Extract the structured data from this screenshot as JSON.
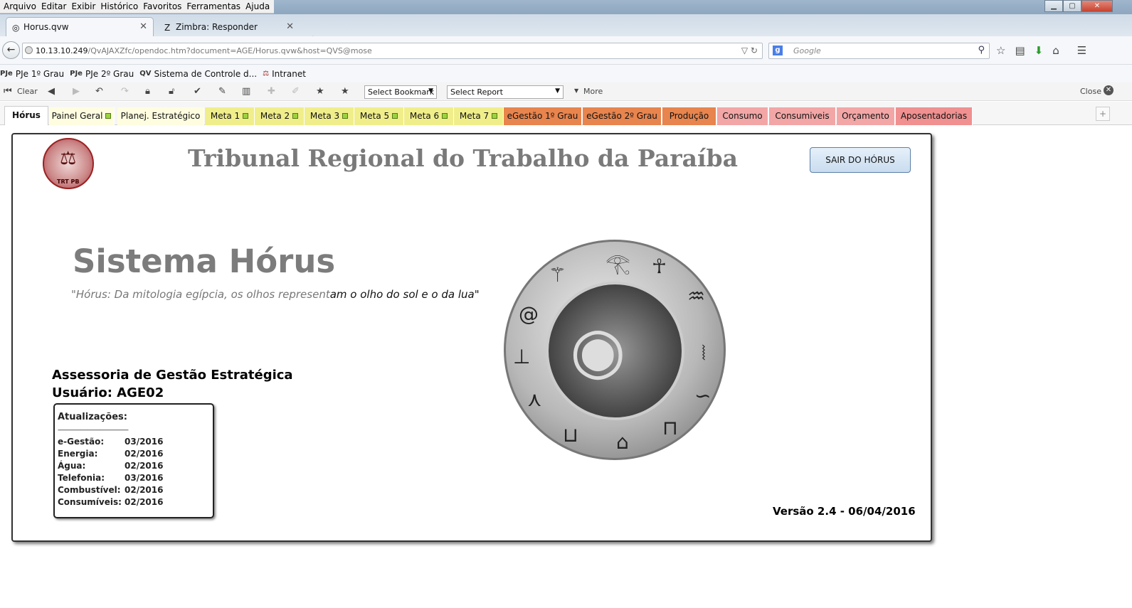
{
  "menubar": [
    "Arquivo",
    "Editar",
    "Exibir",
    "Histórico",
    "Favoritos",
    "Ferramentas",
    "Ajuda"
  ],
  "browser_tabs": [
    {
      "label": "Horus.qvw",
      "active": true
    },
    {
      "label": "Zimbra: Responder",
      "active": false
    }
  ],
  "url": {
    "host": "10.13.10.249",
    "path": "/QvAJAXZfc/opendoc.htm?document=AGE/Horus.qvw&host=QVS@mose"
  },
  "search": {
    "placeholder": "Google"
  },
  "bookmarks": [
    {
      "icon": "PJe",
      "label": "PJe 1º Grau"
    },
    {
      "icon": "PJe",
      "label": "PJe 2º Grau"
    },
    {
      "icon": "QV",
      "label": "Sistema de Controle d..."
    },
    {
      "icon": "⚖",
      "label": "Intranet"
    }
  ],
  "qv_toolbar": {
    "clear": "Clear",
    "select_bookmark": "Select Bookmark",
    "select_report": "Select Report",
    "more": "More",
    "close": "Close"
  },
  "sheet_tabs": [
    {
      "label": "Hórus",
      "color": "#ffffff",
      "dot": false
    },
    {
      "label": "Painel Geral",
      "color": "#fffde0",
      "dot": true
    },
    {
      "label": "Planej. Estratégico",
      "color": "#fffde0",
      "dot": false
    },
    {
      "label": "Meta 1",
      "color": "#f0ee8a",
      "dot": true
    },
    {
      "label": "Meta 2",
      "color": "#f0ee8a",
      "dot": true
    },
    {
      "label": "Meta 3",
      "color": "#f0ee8a",
      "dot": true
    },
    {
      "label": "Meta 5",
      "color": "#f0ee8a",
      "dot": true
    },
    {
      "label": "Meta 6",
      "color": "#f0ee8a",
      "dot": true
    },
    {
      "label": "Meta 7",
      "color": "#f0ee8a",
      "dot": true
    },
    {
      "label": "eGestão 1º Grau",
      "color": "#e8844d",
      "dot": false
    },
    {
      "label": "eGestão 2º Grau",
      "color": "#e8844d",
      "dot": false
    },
    {
      "label": "Produção",
      "color": "#e8844d",
      "dot": false
    },
    {
      "label": "Consumo",
      "color": "#f2a6a6",
      "dot": false
    },
    {
      "label": "Consumiveis",
      "color": "#f2a6a6",
      "dot": false
    },
    {
      "label": "Orçamento",
      "color": "#f2a6a6",
      "dot": false
    },
    {
      "label": "Aposentadorias",
      "color": "#f09090",
      "dot": false
    }
  ],
  "header": {
    "title": "Tribunal Regional do Trabalho da Paraíba",
    "logo_text": "TRT PB",
    "exit_button": "SAIR DO HÓRUS"
  },
  "hero": {
    "title": "Sistema Hórus",
    "quote_a": "\"Hórus: Da mitologia egípcia, os olhos represent",
    "quote_b": "am o olho do sol e o da lua\""
  },
  "user": {
    "department": "Assessoria de Gestão Estratégica",
    "user": "Usuário: AGE02"
  },
  "updates": {
    "title": "Atualizações:",
    "separator": "--------------------------------------------",
    "rows": [
      {
        "k": "e-Gestão:",
        "v": "03/2016"
      },
      {
        "k": "Energia:",
        "v": "02/2016"
      },
      {
        "k": "Água:",
        "v": "02/2016"
      },
      {
        "k": "Telefonia:",
        "v": "03/2016"
      },
      {
        "k": "Combustível:",
        "v": "02/2016"
      },
      {
        "k": "Consumíveis:",
        "v": "02/2016"
      }
    ]
  },
  "version": "Versão 2.4 - 06/04/2016"
}
